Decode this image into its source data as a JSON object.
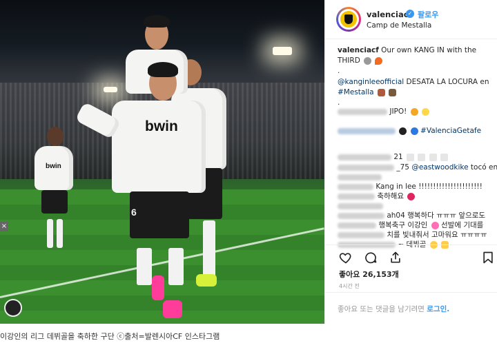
{
  "header": {
    "username": "valenciacf",
    "follow_label": "팔로우",
    "location": "Camp de Mestalla"
  },
  "comments": {
    "caption_user": "valenciacf",
    "caption_text_1": "Our own KANG IN with the",
    "caption_text_2": "THIRD",
    "dot1": ".",
    "mention_kangin": "@kanginleeofficial",
    "caption_text_3": "DESATA LA LOCURA en",
    "hashtag_mestalla": "#Mestalla",
    "dot2": ".",
    "line_jipo": "JIPO!",
    "hashtag_getafe": "#ValenciaGetafe",
    "line_21": "21",
    "line_75": "_75",
    "mention_eastwood": "@eastwoodkike",
    "text_toco": "tocó en",
    "text_kangin": "Kang in lee !!!!!!!!!!!!!!!!!!!!!!",
    "text_congrats": "축하해요",
    "line_ah04": "ah04 행복하다 ㅠㅠㅠ 앞으로도",
    "line_happy": "행복축구 이강인",
    "text_starter": "선발에 기대를",
    "line_thanks": "치를 빛내줘서 고마워요 ㅠㅠㅠㅠ",
    "line_debut": "~ 데뷔골"
  },
  "actions": {
    "likes": "좋아요 26,153개",
    "time": "4시간 전"
  },
  "add_comment": {
    "text": "좋아요 또는 댓글을 남기려면",
    "login": "로그인."
  },
  "photo": {
    "jersey_text": "bwin",
    "jersey_number": "6"
  },
  "page_caption": "이강인의 리그 데뷔골을 축하한 구단  ⓒ출처=발렌시아CF 인스타그램",
  "colors": {
    "link": "#003569",
    "accent": "#3897f0",
    "text": "#262626"
  }
}
